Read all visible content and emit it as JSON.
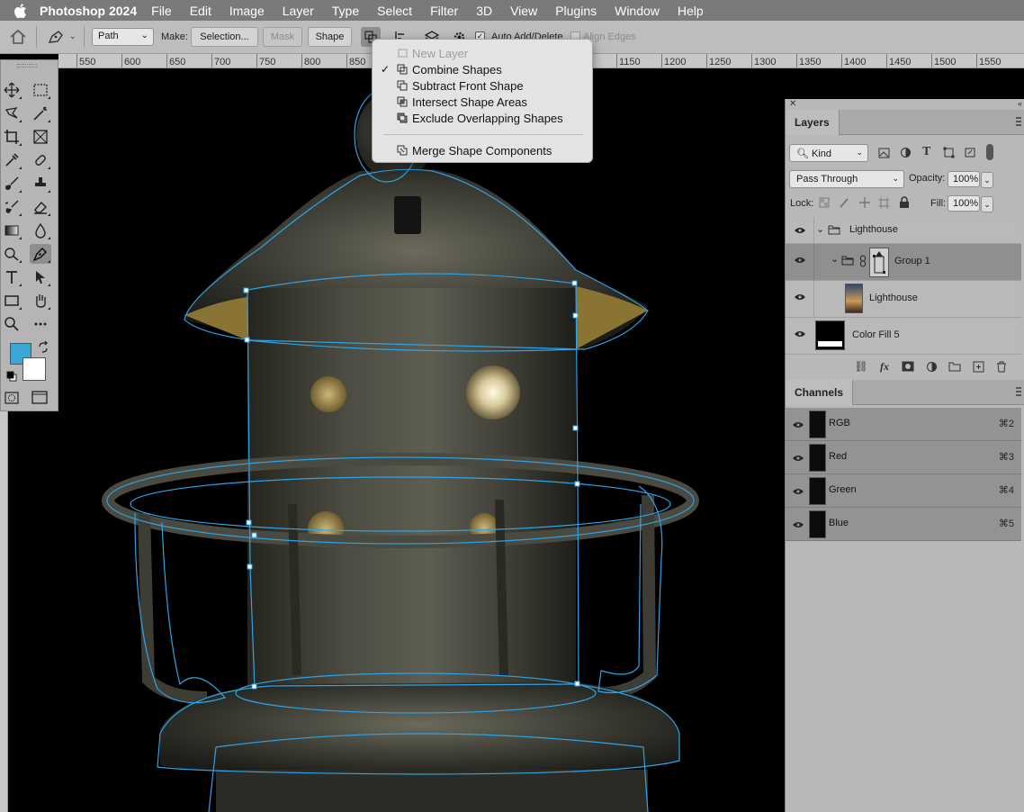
{
  "menubar": {
    "app_name": "Photoshop 2024",
    "items": [
      "File",
      "Edit",
      "Image",
      "Layer",
      "Type",
      "Select",
      "Filter",
      "3D",
      "View",
      "Plugins",
      "Window",
      "Help"
    ]
  },
  "options_bar": {
    "mode": "Path",
    "make_label": "Make:",
    "selection_button": "Selection...",
    "mask_button": "Mask",
    "shape_button": "Shape",
    "auto_add_delete": "Auto Add/Delete",
    "align_edges": "Align Edges"
  },
  "ruler": {
    "ticks": [
      "550",
      "600",
      "650",
      "700",
      "750",
      "800",
      "850",
      "1150",
      "1200",
      "1250",
      "1300",
      "1350",
      "1400",
      "1450",
      "1500",
      "1550"
    ]
  },
  "path_operations_menu": {
    "items": [
      {
        "label": "New Layer",
        "enabled": false,
        "checked": false
      },
      {
        "label": "Combine Shapes",
        "enabled": true,
        "checked": true
      },
      {
        "label": "Subtract Front Shape",
        "enabled": true,
        "checked": false
      },
      {
        "label": "Intersect Shape Areas",
        "enabled": true,
        "checked": false
      },
      {
        "label": "Exclude Overlapping Shapes",
        "enabled": true,
        "checked": false
      },
      {
        "label": "Merge Shape Components",
        "enabled": true,
        "checked": false
      }
    ],
    "check_mark": "✓"
  },
  "toolbar": {
    "foreground_color": "#39a6d8",
    "background_color": "#ffffff"
  },
  "layers_panel": {
    "tab": "Layers",
    "filter_kind": "Kind",
    "blend_mode": "Pass Through",
    "opacity_label": "Opacity:",
    "opacity": "100%",
    "lock_label": "Lock:",
    "fill_label": "Fill:",
    "fill": "100%",
    "layers": [
      {
        "name": "Lighthouse",
        "type": "group",
        "selected": false
      },
      {
        "name": "Group 1",
        "type": "group",
        "selected": true
      },
      {
        "name": "Lighthouse",
        "type": "image",
        "selected": false
      },
      {
        "name": "Color Fill 5",
        "type": "fill",
        "selected": false
      }
    ]
  },
  "channels_panel": {
    "tab": "Channels",
    "channels": [
      {
        "name": "RGB",
        "shortcut": "⌘2"
      },
      {
        "name": "Red",
        "shortcut": "⌘3"
      },
      {
        "name": "Green",
        "shortcut": "⌘4"
      },
      {
        "name": "Blue",
        "shortcut": "⌘5"
      }
    ]
  },
  "colors": {
    "path_stroke": "#2ea3e6",
    "menubar_bg": "#7a7a7a",
    "panel_bg": "#b8b8b8"
  }
}
